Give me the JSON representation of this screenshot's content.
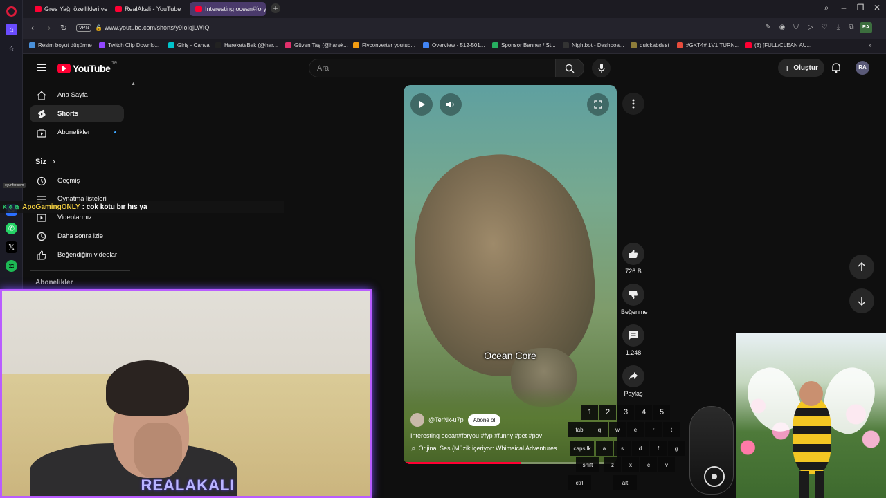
{
  "browser": {
    "tabs": [
      {
        "title": "Gres Yağı özellikleri ve Re"
      },
      {
        "title": "RealAkali - YouTube"
      },
      {
        "title": "Interesting ocean#foryou"
      }
    ],
    "vpn_label": "VPN",
    "url": "www.youtube.com/shorts/y9IoIqjLWIQ",
    "bookmarks": [
      {
        "label": "Resim boyut düşürme",
        "color": "#4a90d9"
      },
      {
        "label": "Twitch Clip Downlo...",
        "color": "#9146ff"
      },
      {
        "label": "Giriş - Canva",
        "color": "#00c4cc"
      },
      {
        "label": "HareketeBak (@har...",
        "color": "#222222"
      },
      {
        "label": "Güven Taş (@harek...",
        "color": "#e1306c"
      },
      {
        "label": "Flvconverter youtub...",
        "color": "#f39c12"
      },
      {
        "label": "Overview - 512-501...",
        "color": "#4285f4"
      },
      {
        "label": "Sponsor Banner / St...",
        "color": "#27ae60"
      },
      {
        "label": "Nightbot - Dashboa...",
        "color": "#333333"
      },
      {
        "label": "quickabdest",
        "color": "#8e7d3a"
      },
      {
        "label": "#GKT4# 1V1 TURN...",
        "color": "#e74c3c"
      },
      {
        "label": "(8) [FULL/CLEAN AU...",
        "color": "#ff0033"
      }
    ]
  },
  "youtube": {
    "logo_text": "YouTube",
    "country": "TR",
    "search_placeholder": "Ara",
    "create_label": "Oluştur",
    "avatar_initials": "RA",
    "sidebar": {
      "items": [
        {
          "label": "Ana Sayfa"
        },
        {
          "label": "Shorts"
        },
        {
          "label": "Abonelikler"
        }
      ],
      "you_heading": "Siz",
      "you_items": [
        {
          "label": "Geçmiş"
        },
        {
          "label": "Oynatma listeleri"
        },
        {
          "label": "Videolarınız"
        },
        {
          "label": "Daha sonra izle"
        },
        {
          "label": "Beğendiğim videolar"
        }
      ],
      "subs_heading": "Abonelikler"
    },
    "short": {
      "caption": "Ocean Core",
      "channel": "@TerNk-u7p",
      "subscribe_label": "Abone ol",
      "description": "Interesting ocean#foryou #fyp #funny #pet #pov",
      "sound": "♬ Orijinal Ses (Müzik içeriyor: Whimsical Adventures",
      "progress": 0.55
    },
    "actions": {
      "likes": "726 B",
      "dislike_label": "Beğenme",
      "comments": "1.248",
      "share_label": "Paylaş"
    }
  },
  "overlay": {
    "chat": {
      "badge": "K ❖ ⧉",
      "user": "ApoGamingONLY",
      "message": ": cok kotu bır hıs ya"
    },
    "twitch_tag": "oyunfor.com",
    "streamer_name": "REALAKALI",
    "keyboard": {
      "number_row": [
        "1",
        "2",
        "3",
        "4",
        "5"
      ],
      "row2": [
        "tab",
        "q",
        "w",
        "e",
        "r",
        "t"
      ],
      "row3": [
        "caps lk",
        "a",
        "s",
        "d",
        "f",
        "g"
      ],
      "row4": [
        "shift",
        "z",
        "x",
        "c",
        "v"
      ],
      "row5": [
        "ctrl",
        "alt"
      ]
    }
  }
}
